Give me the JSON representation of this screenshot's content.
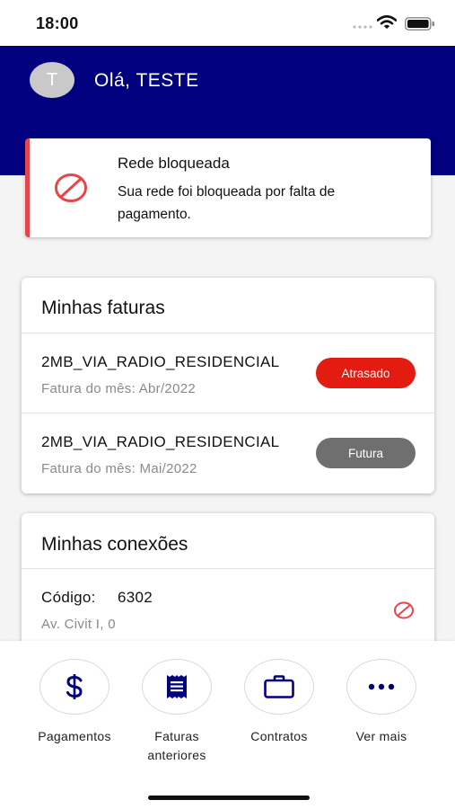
{
  "status_bar": {
    "time": "18:00"
  },
  "header": {
    "avatar_initial": "T",
    "greeting": "Olá, TESTE",
    "background": "#01017f"
  },
  "alert": {
    "title": "Rede bloqueada",
    "message": "Sua rede foi bloqueada por falta de pagamento.",
    "icon": "blocked-icon",
    "accent": "#e8454a"
  },
  "invoices": {
    "title": "Minhas faturas",
    "items": [
      {
        "plan": "2MB_VIA_RADIO_RESIDENCIAL",
        "period": "Fatura do mês: Abr/2022",
        "status": "Atrasado",
        "status_color": "#e31b10"
      },
      {
        "plan": "2MB_VIA_RADIO_RESIDENCIAL",
        "period": "Fatura do mês: Mai/2022",
        "status": "Futura",
        "status_color": "#6f6f6f"
      }
    ]
  },
  "connections": {
    "title": "Minhas conexões",
    "items": [
      {
        "code_label": "Código:",
        "code": "6302",
        "address": "Av. Civit I, 0",
        "icon": "blocked-icon"
      }
    ]
  },
  "actions": [
    {
      "label": "Pagamentos",
      "icon": "dollar-icon"
    },
    {
      "label": "Faturas anteriores",
      "icon": "receipt-icon"
    },
    {
      "label": "Contratos",
      "icon": "briefcase-icon"
    },
    {
      "label": "Ver mais",
      "icon": "more-icon"
    }
  ]
}
